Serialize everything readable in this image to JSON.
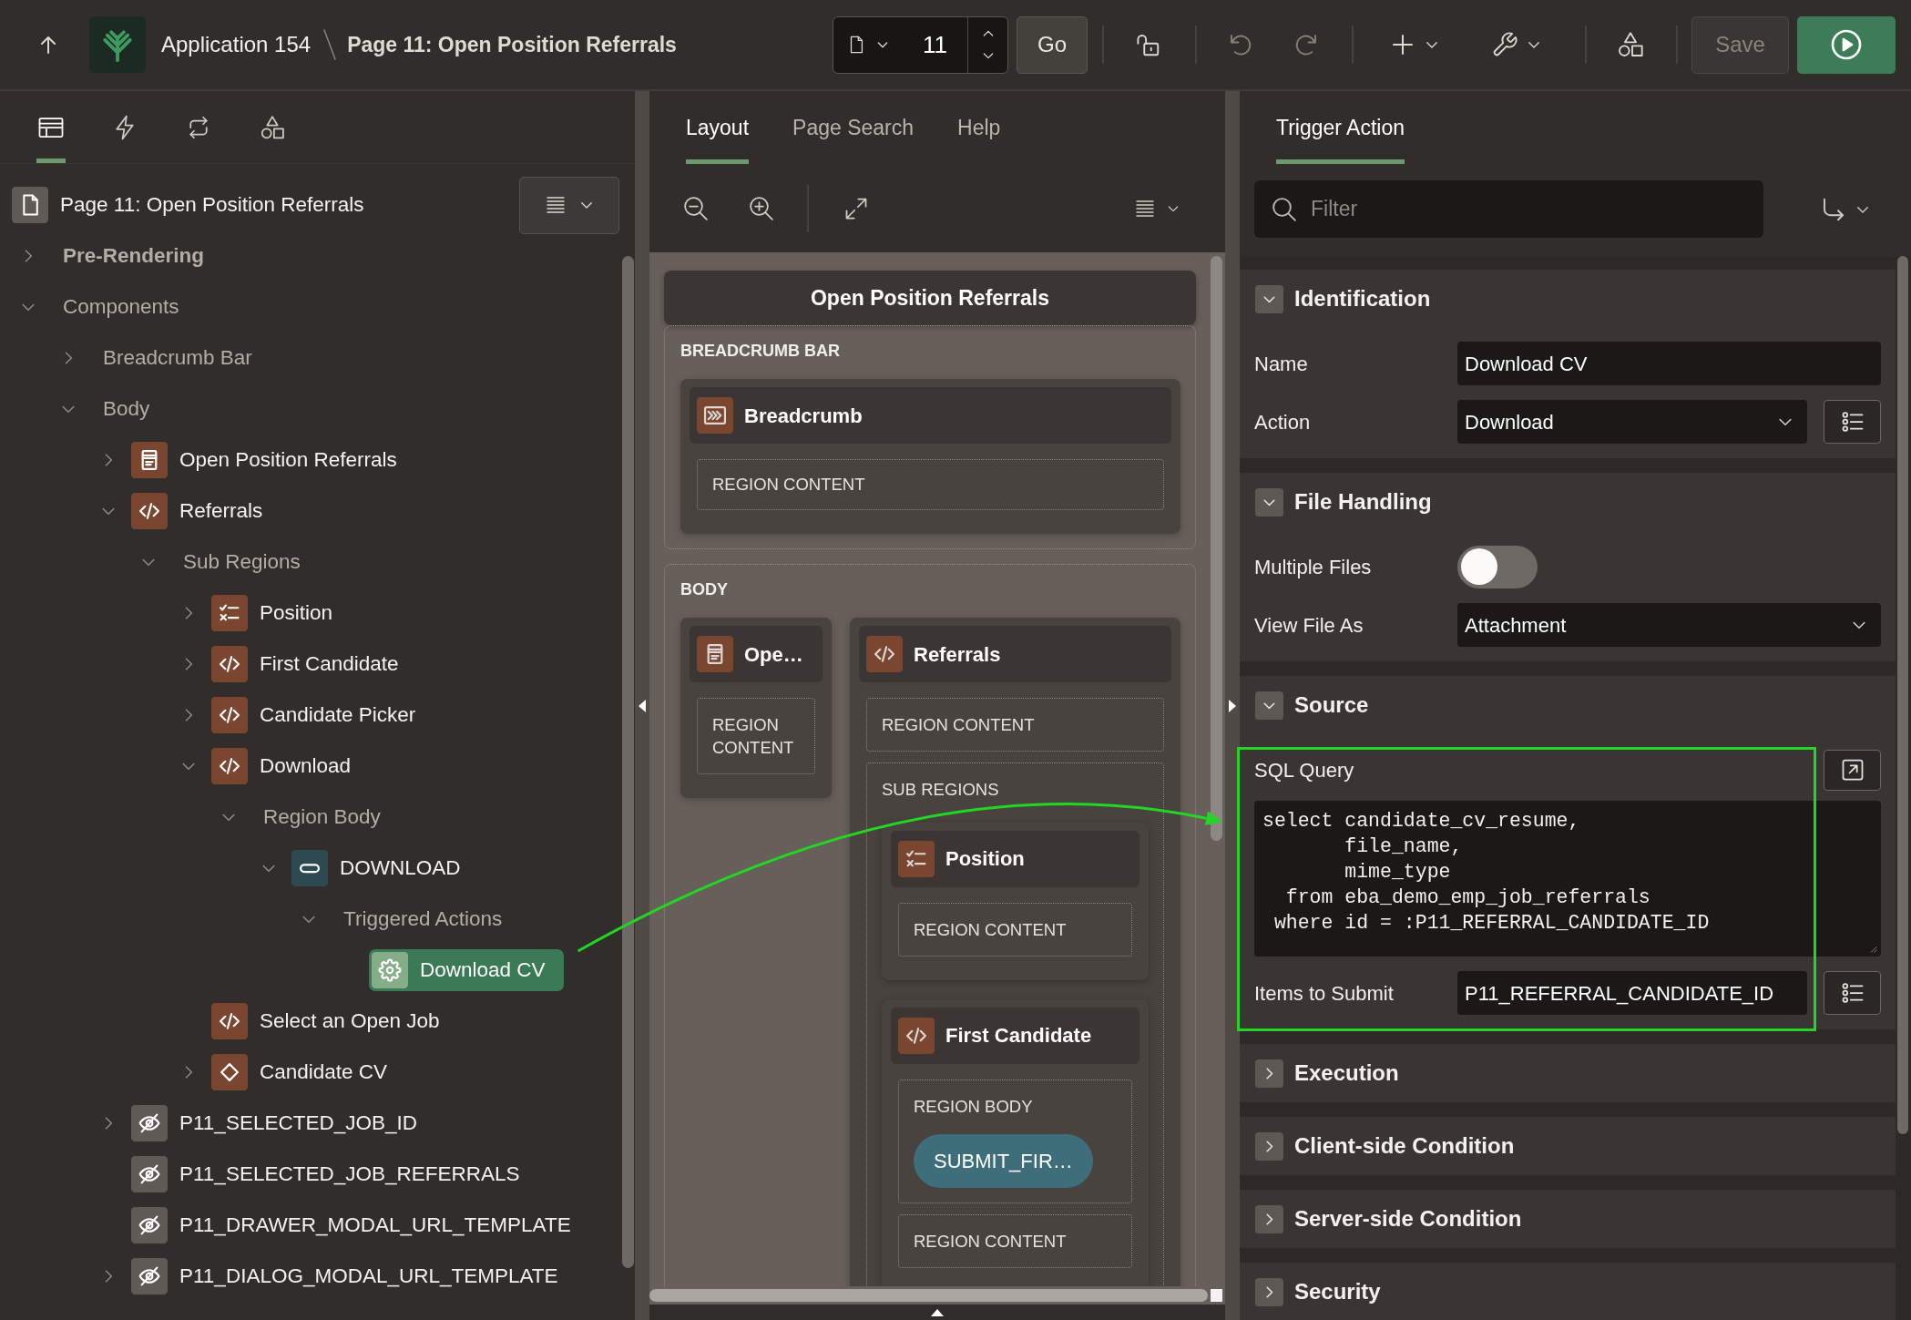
{
  "top_bar": {
    "app_name": "Application 154",
    "page_title": "Page 11: Open Position Referrals",
    "page_number": "11",
    "go_button": "Go",
    "undo": {
      "disabled": true
    },
    "redo": {
      "disabled": true
    },
    "save_button": {
      "label": "Save",
      "disabled": true
    }
  },
  "left_panel": {
    "tabs": [
      {
        "kind": "rendering",
        "selected": true
      },
      {
        "kind": "dynamic",
        "selected": false
      },
      {
        "kind": "processing",
        "selected": false
      },
      {
        "kind": "shared",
        "selected": false
      }
    ],
    "tree": {
      "root": {
        "label": "Page 11: Open Position Referrals",
        "selected": false
      },
      "nodes": [
        {
          "label": "Pre-Rendering",
          "kind": "heading",
          "bold": true,
          "expanded": false,
          "selected": false
        },
        {
          "label": "Components",
          "kind": "heading",
          "expanded": true,
          "selected": false,
          "children": [
            {
              "label": "Breadcrumb Bar",
              "kind": "heading",
              "expanded": false,
              "selected": false
            },
            {
              "label": "Body",
              "kind": "heading",
              "expanded": true,
              "selected": false,
              "children": [
                {
                  "label": "Open Position Referrals",
                  "kind": "form",
                  "expanded": false,
                  "selected": false
                },
                {
                  "label": "Referrals",
                  "kind": "code",
                  "expanded": true,
                  "selected": false,
                  "children": [
                    {
                      "label": "Sub Regions",
                      "kind": "heading",
                      "expanded": true,
                      "selected": false,
                      "children": [
                        {
                          "label": "Position",
                          "kind": "checklist",
                          "expanded": false,
                          "selected": false
                        },
                        {
                          "label": "First Candidate",
                          "kind": "code",
                          "expanded": false,
                          "selected": false
                        },
                        {
                          "label": "Candidate Picker",
                          "kind": "code",
                          "expanded": false,
                          "selected": false
                        },
                        {
                          "label": "Download",
                          "kind": "code",
                          "expanded": true,
                          "selected": false,
                          "children": [
                            {
                              "label": "Region Body",
                              "kind": "heading",
                              "expanded": true,
                              "selected": false,
                              "children": [
                                {
                                  "label": "DOWNLOAD",
                                  "kind": "button",
                                  "expanded": true,
                                  "selected": false,
                                  "children": [
                                    {
                                      "label": "Triggered Actions",
                                      "kind": "heading",
                                      "expanded": true,
                                      "selected": false,
                                      "children": [
                                        {
                                          "label": "Download CV",
                                          "kind": "action",
                                          "selected": true,
                                          "callout": true
                                        }
                                      ]
                                    }
                                  ]
                                }
                              ]
                            }
                          ]
                        },
                        {
                          "label": "Select an Open Job",
                          "kind": "code",
                          "selected": false
                        },
                        {
                          "label": "Candidate CV",
                          "kind": "diamond",
                          "expanded": false,
                          "selected": false
                        }
                      ]
                    }
                  ]
                },
                {
                  "label": "P11_SELECTED_JOB_ID",
                  "kind": "hidden",
                  "expanded": false,
                  "selected": false
                },
                {
                  "label": "P11_SELECTED_JOB_REFERRALS",
                  "kind": "hidden",
                  "selected": false
                },
                {
                  "label": "P11_DRAWER_MODAL_URL_TEMPLATE",
                  "kind": "hidden",
                  "selected": false
                },
                {
                  "label": "P11_DIALOG_MODAL_URL_TEMPLATE",
                  "kind": "hidden",
                  "expanded": false,
                  "selected": false
                }
              ]
            }
          ]
        }
      ]
    }
  },
  "layout_panel": {
    "tabs": [
      {
        "label": "Layout",
        "selected": true
      },
      {
        "label": "Page Search",
        "selected": false
      },
      {
        "label": "Help",
        "selected": false
      }
    ],
    "canvas": {
      "title": "Open Position Referrals",
      "positions": [
        {
          "label": "BREADCRUMB BAR",
          "regions": [
            {
              "title": "Breadcrumb",
              "kind": "breadcrumb",
              "slots": [
                {
                  "label": "REGION CONTENT"
                }
              ]
            }
          ]
        },
        {
          "label": "BODY",
          "regions": [
            {
              "title": "Ope…",
              "kind": "form",
              "slots": [
                {
                  "label": "REGION CONTENT"
                }
              ]
            },
            {
              "title": "Referrals",
              "kind": "code",
              "slots": [
                {
                  "label": "REGION CONTENT"
                },
                {
                  "label": "SUB REGIONS",
                  "regions": [
                    {
                      "title": "Position",
                      "kind": "checklist",
                      "slots": [
                        {
                          "label": "REGION CONTENT"
                        }
                      ]
                    },
                    {
                      "title": "First Candidate",
                      "kind": "code",
                      "slots": [
                        {
                          "label": "REGION BODY",
                          "buttons": [
                            "SUBMIT_FIR…"
                          ]
                        },
                        {
                          "label": "REGION CONTENT"
                        }
                      ]
                    }
                  ]
                }
              ]
            }
          ]
        }
      ]
    }
  },
  "property_panel": {
    "tabs": [
      {
        "label": "Trigger Action",
        "selected": true
      }
    ],
    "filter": {
      "placeholder": "Filter"
    },
    "sections": [
      {
        "title": "Identification",
        "expanded": true,
        "fields": [
          {
            "label": "Name",
            "kind": "text",
            "value": "Download CV"
          },
          {
            "label": "Action",
            "kind": "select",
            "value": "Download",
            "list_button": true
          }
        ]
      },
      {
        "title": "File Handling",
        "expanded": true,
        "fields": [
          {
            "label": "Multiple Files",
            "kind": "switch",
            "on": false
          },
          {
            "label": "View File As",
            "kind": "select",
            "value": "Attachment"
          }
        ]
      },
      {
        "title": "Source",
        "expanded": true,
        "highlighted": true,
        "fields": [
          {
            "label": "SQL Query",
            "kind": "code",
            "value": "select candidate_cv_resume,\n       file_name,\n       mime_type\n  from eba_demo_emp_job_referrals\n where id = :P11_REFERRAL_CANDIDATE_ID"
          },
          {
            "label": "Items to Submit",
            "kind": "text",
            "value": "P11_REFERRAL_CANDIDATE_ID",
            "list_button": true
          }
        ]
      },
      {
        "title": "Execution",
        "expanded": false
      },
      {
        "title": "Client-side Condition",
        "expanded": false
      },
      {
        "title": "Server-side Condition",
        "expanded": false
      },
      {
        "title": "Security",
        "expanded": false
      }
    ]
  }
}
